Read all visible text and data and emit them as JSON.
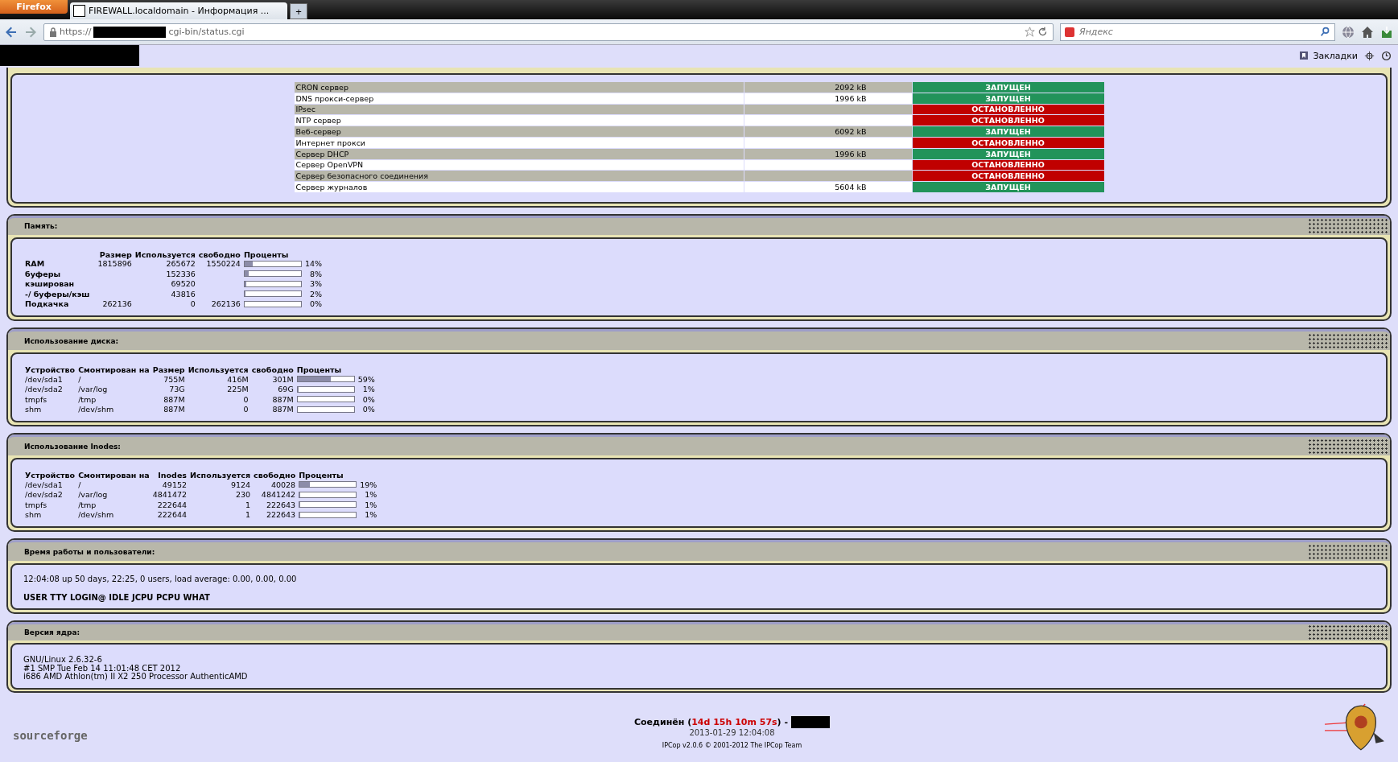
{
  "browser": {
    "menu_button": "Firefox",
    "tab_title": "FIREWALL.localdomain - Информация ...",
    "new_tab": "+",
    "url_scheme": "https://",
    "url_path": "cgi-bin/status.cgi",
    "search_placeholder": "Яндекс",
    "bookmarks_label": "Закладки"
  },
  "services": [
    {
      "name": "CRON сервер",
      "memory": "2092 kB",
      "status": "ЗАПУЩЕН",
      "running": true
    },
    {
      "name": "DNS прокси-сервер",
      "memory": "1996 kB",
      "status": "ЗАПУЩЕН",
      "running": true
    },
    {
      "name": "IPsec",
      "status": "ОСТАНОВЛЕННО",
      "running": false
    },
    {
      "name": "NTP сервер",
      "status": "ОСТАНОВЛЕННО",
      "running": false
    },
    {
      "name": "Веб-сервер",
      "memory": "6092 kB",
      "status": "ЗАПУЩЕН",
      "running": true
    },
    {
      "name": "Интернет прокси",
      "status": "ОСТАНОВЛЕННО",
      "running": false
    },
    {
      "name": "Сервер DHCP",
      "memory": "1996 kB",
      "status": "ЗАПУЩЕН",
      "running": true
    },
    {
      "name": "Сервер OpenVPN",
      "status": "ОСТАНОВЛЕННО",
      "running": false
    },
    {
      "name": "Сервер безопасного соединения",
      "status": "ОСТАНОВЛЕННО",
      "running": false
    },
    {
      "name": "Сервер журналов",
      "memory": "5604 kB",
      "status": "ЗАПУЩЕН",
      "running": true
    }
  ],
  "memory": {
    "title": "Память:",
    "columns": [
      "Размер",
      "Используется",
      "свободно",
      "Проценты"
    ],
    "rows": [
      {
        "label": "RAM",
        "size": "1815896",
        "used": "265672",
        "free": "1550224",
        "level": 0.14,
        "percent": "14%"
      },
      {
        "label": "буферы",
        "used": "152336",
        "level": 0.08,
        "percent": "8%"
      },
      {
        "label": "кэширован",
        "used": "69520",
        "level": 0.03,
        "percent": "3%"
      },
      {
        "label": "-/ буферы/кэш",
        "used": "43816",
        "level": 0.02,
        "percent": "2%"
      },
      {
        "label": "Подкачка",
        "size": "262136",
        "used": "0",
        "free": "262136",
        "level": 0,
        "percent": "0%"
      }
    ]
  },
  "disk": {
    "title": "Использование диска:",
    "columns": [
      "Устройство",
      "Смонтирован на",
      "Размер",
      "Используется",
      "свободно",
      "Проценты"
    ],
    "rows": [
      {
        "device": "/dev/sda1",
        "mount": "/",
        "size": "755M",
        "used": "416M",
        "free": "301M",
        "level": 0.59,
        "percent": "59%"
      },
      {
        "device": "/dev/sda2",
        "mount": "/var/log",
        "size": "73G",
        "used": "225M",
        "free": "69G",
        "level": 0.01,
        "percent": "1%"
      },
      {
        "device": "tmpfs",
        "mount": "/tmp",
        "size": "887M",
        "used": "0",
        "free": "887M",
        "level": 0,
        "percent": "0%"
      },
      {
        "device": "shm",
        "mount": "/dev/shm",
        "size": "887M",
        "used": "0",
        "free": "887M",
        "level": 0,
        "percent": "0%"
      }
    ]
  },
  "inodes": {
    "title": "Использование Inodes:",
    "columns": [
      "Устройство",
      "Смонтирован на",
      "Inodes",
      "Используется",
      "свободно",
      "Проценты"
    ],
    "rows": [
      {
        "device": "/dev/sda1",
        "mount": "/",
        "size": "49152",
        "used": "9124",
        "free": "40028",
        "level": 0.19,
        "percent": "19%"
      },
      {
        "device": "/dev/sda2",
        "mount": "/var/log",
        "size": "4841472",
        "used": "230",
        "free": "4841242",
        "level": 0.01,
        "percent": "1%"
      },
      {
        "device": "tmpfs",
        "mount": "/tmp",
        "size": "222644",
        "used": "1",
        "free": "222643",
        "level": 0.01,
        "percent": "1%"
      },
      {
        "device": "shm",
        "mount": "/dev/shm",
        "size": "222644",
        "used": "1",
        "free": "222643",
        "level": 0.01,
        "percent": "1%"
      }
    ]
  },
  "uptime": {
    "title": "Время работы и пользователи:",
    "line": "12:04:08 up 50 days, 22:25, 0 users, load average: 0.00, 0.00, 0.00",
    "users_header": "USER TTY LOGIN@ IDLE JCPU PCPU WHAT"
  },
  "kernel": {
    "title": "Версия ядра:",
    "lines": [
      "GNU/Linux 2.6.32-6",
      "#1 SMP Tue Feb 14 11:01:48 CET 2012",
      "i686 AMD Athlon(tm) II X2 250 Processor AuthenticAMD"
    ]
  },
  "footer": {
    "logo": "sourceforge",
    "connected": "Соединён (",
    "duration": "14d 15h 10m 57s",
    "connected_end": ") -",
    "date": "2013-01-29 12:04:08",
    "credit": "IPCop v2.0.6 © 2001-2012 The IPCop Team"
  }
}
